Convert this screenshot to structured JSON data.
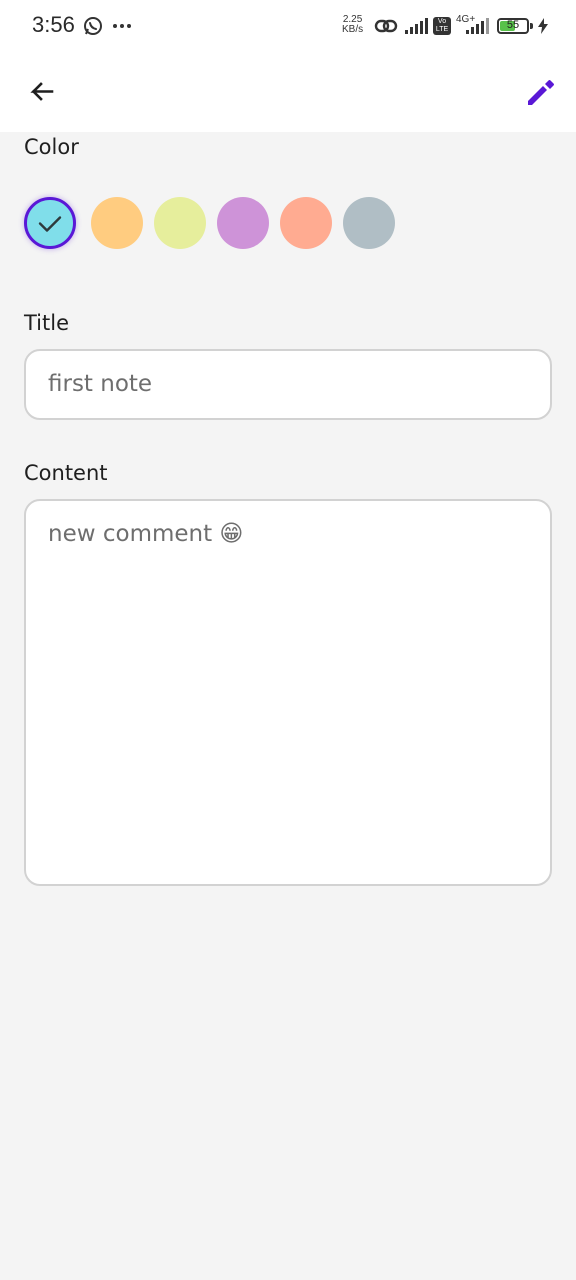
{
  "status_bar": {
    "time": "3:56",
    "speed_value": "2.25",
    "speed_unit": "KB/s",
    "network": "4G+",
    "volte": "Vo LTE",
    "battery": "55"
  },
  "app_bar": {
    "back_icon": "arrow-back-icon",
    "edit_icon": "pencil-icon",
    "accent_color": "#5a18d6"
  },
  "color_section": {
    "label": "Color",
    "swatches": [
      {
        "color": "#80deea",
        "selected": true
      },
      {
        "color": "#ffcc80"
      },
      {
        "color": "#e6ee9c"
      },
      {
        "color": "#ce93d8"
      },
      {
        "color": "#ffab91"
      },
      {
        "color": "#b0bec5"
      }
    ]
  },
  "title_section": {
    "label": "Title",
    "value": "first note"
  },
  "content_section": {
    "label": "Content",
    "value": "new comment 😁"
  }
}
